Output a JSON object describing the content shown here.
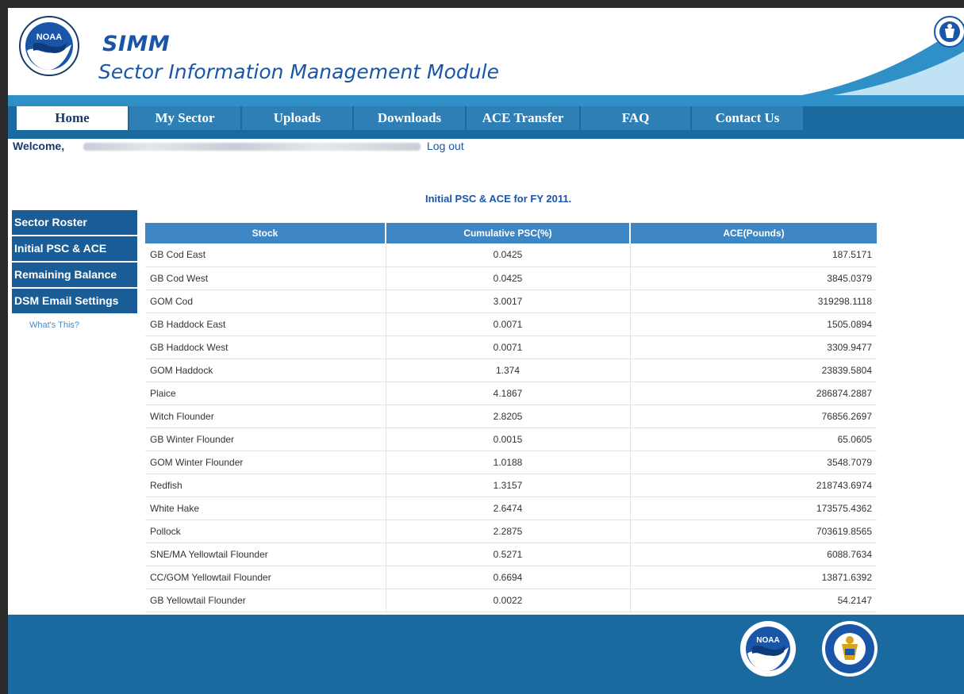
{
  "header": {
    "app_title": "SIMM",
    "app_subtitle": "Sector Information Management Module",
    "logo_icon": "noaa-logo",
    "seal_icon": "doc-seal"
  },
  "nav": {
    "items": [
      {
        "label": "Home",
        "active": true
      },
      {
        "label": "My Sector",
        "active": false
      },
      {
        "label": "Uploads",
        "active": false
      },
      {
        "label": "Downloads",
        "active": false
      },
      {
        "label": "ACE Transfer",
        "active": false
      },
      {
        "label": "FAQ",
        "active": false
      },
      {
        "label": "Contact Us",
        "active": false
      }
    ]
  },
  "welcome": {
    "label": "Welcome,",
    "logout": "Log out"
  },
  "sidebar": {
    "items": [
      {
        "label": "Sector Roster"
      },
      {
        "label": "Initial PSC & ACE"
      },
      {
        "label": "Remaining Balance"
      },
      {
        "label": "DSM Email Settings"
      }
    ],
    "help_link": "What's This?"
  },
  "content": {
    "title": "Initial PSC & ACE for FY 2011."
  },
  "table": {
    "headers": [
      "Stock",
      "Cumulative PSC(%)",
      "ACE(Pounds)"
    ],
    "rows": [
      [
        "GB Cod East",
        "0.0425",
        "187.5171"
      ],
      [
        "GB Cod West",
        "0.0425",
        "3845.0379"
      ],
      [
        "GOM Cod",
        "3.0017",
        "319298.1118"
      ],
      [
        "GB Haddock East",
        "0.0071",
        "1505.0894"
      ],
      [
        "GB Haddock West",
        "0.0071",
        "3309.9477"
      ],
      [
        "GOM Haddock",
        "1.374",
        "23839.5804"
      ],
      [
        "Plaice",
        "4.1867",
        "286874.2887"
      ],
      [
        "Witch Flounder",
        "2.8205",
        "76856.2697"
      ],
      [
        "GB Winter Flounder",
        "0.0015",
        "65.0605"
      ],
      [
        "GOM Winter Flounder",
        "1.0188",
        "3548.7079"
      ],
      [
        "Redfish",
        "1.3157",
        "218743.6974"
      ],
      [
        "White Hake",
        "2.6474",
        "173575.4362"
      ],
      [
        "Pollock",
        "2.2875",
        "703619.8565"
      ],
      [
        "SNE/MA Yellowtail Flounder",
        "0.5271",
        "6088.7634"
      ],
      [
        "CC/GOM Yellowtail Flounder",
        "0.6694",
        "13871.6392"
      ],
      [
        "GB Yellowtail Flounder",
        "0.0022",
        "54.2147"
      ]
    ]
  },
  "colors": {
    "brand_blue": "#1a56a8",
    "nav_bg": "#1a6aa0",
    "nav_item": "#2d7fb6",
    "sidebar_bg": "#1a5d96",
    "table_header": "#3f87c4"
  }
}
